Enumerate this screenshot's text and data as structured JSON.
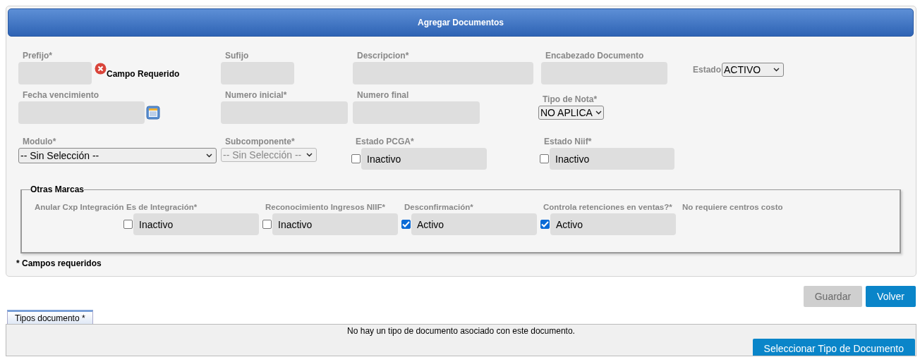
{
  "header": {
    "title": "Agregar Documentos"
  },
  "rows": [
    {
      "fields": [
        {
          "kind": "text",
          "label": "Prefijo*",
          "error": "Campo Requerido"
        },
        {
          "kind": "text",
          "label": "Sufijo"
        },
        {
          "kind": "text",
          "label": "Descripcion*"
        },
        {
          "kind": "text",
          "label": "Encabezado Documento"
        },
        {
          "kind": "inline_select",
          "label": "Estado",
          "value": "ACTIVO",
          "disabled": false
        }
      ]
    },
    {
      "fields": [
        {
          "kind": "date",
          "label": "Fecha vencimiento"
        },
        {
          "kind": "text",
          "label": "Numero inicial*"
        },
        {
          "kind": "text",
          "label": "Numero final"
        },
        {
          "kind": "select",
          "label": "Tipo de Nota*",
          "value": "NO APLICA",
          "disabled": false
        }
      ]
    },
    {
      "fields": [
        {
          "kind": "select",
          "label": "Modulo*",
          "value": "-- Sin Selección --",
          "disabled": false
        },
        {
          "kind": "select",
          "label": "Subcomponente*",
          "value": "-- Sin Selección --",
          "disabled": true
        },
        {
          "kind": "check",
          "label": "Estado PCGA*",
          "checked": false,
          "text": "Inactivo"
        },
        {
          "kind": "check",
          "label": "Estado Niif*",
          "checked": false,
          "text": "Inactivo"
        }
      ]
    }
  ],
  "other_marks": {
    "legend": "Otras Marcas",
    "items": [
      {
        "kind": "label",
        "label": "Anular Cxp Integración"
      },
      {
        "kind": "check",
        "label": "Es de Integración*",
        "checked": false,
        "text": "Inactivo"
      },
      {
        "kind": "check",
        "label": "Reconocimiento Ingresos NIIF*",
        "checked": false,
        "text": "Inactivo"
      },
      {
        "kind": "check",
        "label": "Desconfirmación*",
        "checked": true,
        "text": "Activo"
      },
      {
        "kind": "check",
        "label": "Controla retenciones en ventas?*",
        "checked": true,
        "text": "Activo"
      },
      {
        "kind": "label",
        "label": "No requiere centros costo"
      }
    ]
  },
  "required_note": "* Campos requeridos",
  "buttons": [
    {
      "label": "Guardar",
      "disabled": true
    },
    {
      "label": "Volver",
      "disabled": false
    }
  ],
  "tabs": [
    {
      "label": "Tipos documento *",
      "selected": true
    }
  ],
  "tab_panel": {
    "message": "No hay un tipo de documento asociado con este documento.",
    "button": "Seleccionar Tipo de Documento"
  }
}
